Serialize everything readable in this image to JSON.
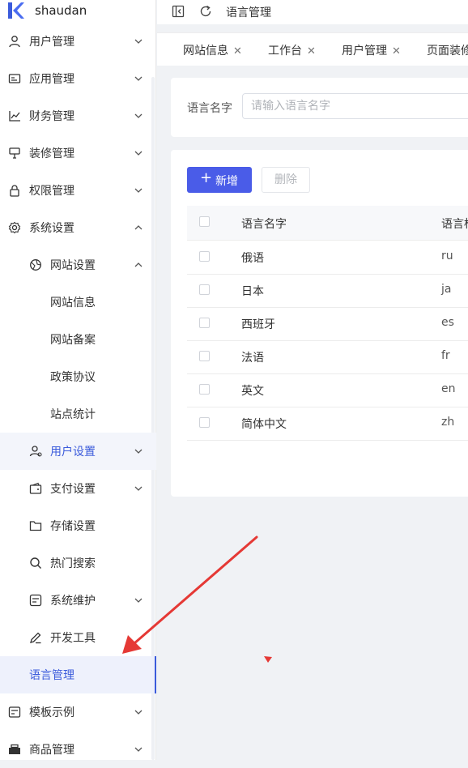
{
  "app": {
    "name": "shaudan"
  },
  "sidebar": {
    "items": [
      {
        "label": "用户管理",
        "icon": "user-icon"
      },
      {
        "label": "应用管理",
        "icon": "app-icon"
      },
      {
        "label": "财务管理",
        "icon": "chart-icon"
      },
      {
        "label": "装修管理",
        "icon": "paint-icon"
      },
      {
        "label": "权限管理",
        "icon": "lock-icon"
      },
      {
        "label": "系统设置",
        "icon": "gear-icon"
      },
      {
        "label": "网站设置",
        "icon": "globe-icon"
      },
      {
        "label": "网站信息"
      },
      {
        "label": "网站备案"
      },
      {
        "label": "政策协议"
      },
      {
        "label": "站点统计"
      },
      {
        "label": "用户设置",
        "icon": "users-icon"
      },
      {
        "label": "支付设置",
        "icon": "wallet-icon"
      },
      {
        "label": "存储设置",
        "icon": "folder-icon"
      },
      {
        "label": "热门搜索",
        "icon": "search-icon"
      },
      {
        "label": "系统维护",
        "icon": "maintenance-icon"
      },
      {
        "label": "开发工具",
        "icon": "pen-icon"
      },
      {
        "label": "语言管理"
      },
      {
        "label": "模板示例",
        "icon": "template-icon"
      },
      {
        "label": "商品管理",
        "icon": "goods-icon"
      }
    ]
  },
  "header": {
    "breadcrumb": "语言管理"
  },
  "tabs": [
    {
      "label": "网站信息"
    },
    {
      "label": "工作台"
    },
    {
      "label": "用户管理"
    },
    {
      "label": "页面装修"
    }
  ],
  "search": {
    "label": "语言名字",
    "placeholder": "请输入语言名字",
    "value": ""
  },
  "toolbar": {
    "add_label": "新增",
    "delete_label": "删除"
  },
  "table": {
    "columns": [
      "语言名字",
      "语言标识"
    ],
    "rows": [
      {
        "name": "俄语",
        "code": "ru"
      },
      {
        "name": "日本",
        "code": "ja"
      },
      {
        "name": "西班牙",
        "code": "es"
      },
      {
        "name": "法语",
        "code": "fr"
      },
      {
        "name": "英文",
        "code": "en"
      },
      {
        "name": "简体中文",
        "code": "zh"
      }
    ]
  },
  "colors": {
    "accent": "#4a5ce8",
    "active_text": "#3b5bdb",
    "annotation": "#e53935"
  }
}
